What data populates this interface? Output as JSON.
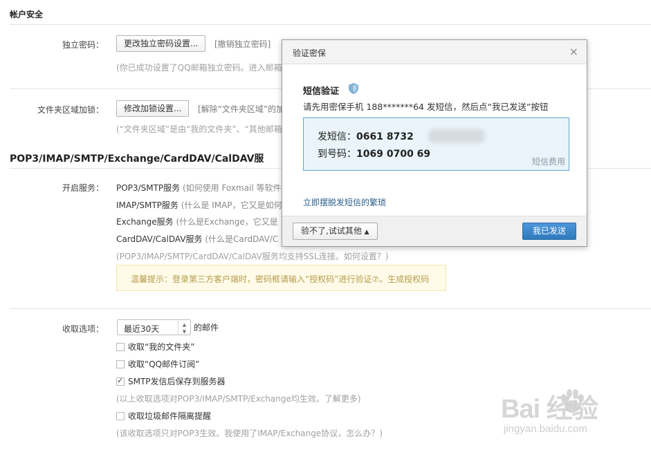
{
  "account_security": {
    "title": "帐户安全",
    "independent_password": {
      "label": "独立密码：",
      "button": "更改独立密码设置...",
      "revoke_link": "[撤销独立密码]",
      "hint": "(你已成功设置了QQ邮箱独立密码。进入邮箱"
    },
    "folder_lock": {
      "label": "文件夹区域加锁：",
      "button": "修改加锁设置...",
      "release_link": "[解除“文件夹区域”的加",
      "hint": "(“文件夹区域”是由“我的文件夹”、“其他邮箱"
    }
  },
  "protocols": {
    "title": "POP3/IMAP/SMTP/Exchange/CardDAV/CalDAV服",
    "label": "开启服务：",
    "services": [
      {
        "name": "POP3/SMTP服务",
        "note": " (如何使用 Foxmail 等软件"
      },
      {
        "name": "IMAP/SMTP服务",
        "note": " (什么是 IMAP，它又是如何"
      },
      {
        "name": "Exchange服务",
        "note": " (什么是Exchange，它又是"
      },
      {
        "name": "CardDAV/CalDAV服务",
        "note": " (什么是CardDAV/C"
      }
    ],
    "ssl_hint": "(POP3/IMAP/SMTP/CardDAV/CalDAV服务均支持SSL连接。如何设置？)",
    "tip": "温馨提示：登录第三方客户端时，密码框请输入“授权码”进行验证⑦。生成授权码"
  },
  "receive": {
    "label": "收取选项：",
    "select_value": "最近30天",
    "suffix": "的邮件",
    "options": [
      {
        "label": "收取“我的文件夹”",
        "checked": false
      },
      {
        "label": "收取“QQ邮件订阅”",
        "checked": false
      },
      {
        "label": "SMTP发信后保存到服务器",
        "checked": true
      }
    ],
    "options_hint": "(以上收取选项对POP3/IMAP/SMTP/Exchange均生效。了解更多)",
    "spam_option": {
      "label": "收取垃圾邮件隔离提醒",
      "checked": false
    },
    "spam_hint": "(该收取选项只对POP3生效。我使用了IMAP/Exchange协议，怎么办？)"
  },
  "modal": {
    "title": "验证密保",
    "close": "×",
    "sms_title": "短信验证",
    "description": "请先用密保手机 188*******64 发短信，然后点“我已发送”按钮",
    "send_label": "发短信：",
    "send_value": "0661 8732",
    "to_label": "到号码：",
    "to_value": "1069 0700 69",
    "fee": "短信费用",
    "escape_link": "立即摆脱发短信的繁琐",
    "other_button": "验不了,试试其他",
    "sent_button": "我已发送"
  },
  "watermark": {
    "main": "Bai  经验",
    "sub": "jingyan.baidu.com"
  },
  "colors": {
    "accent_blue": "#2f79bd",
    "tip_bg": "#fffbe8",
    "code_bg": "#eaf4fa"
  }
}
